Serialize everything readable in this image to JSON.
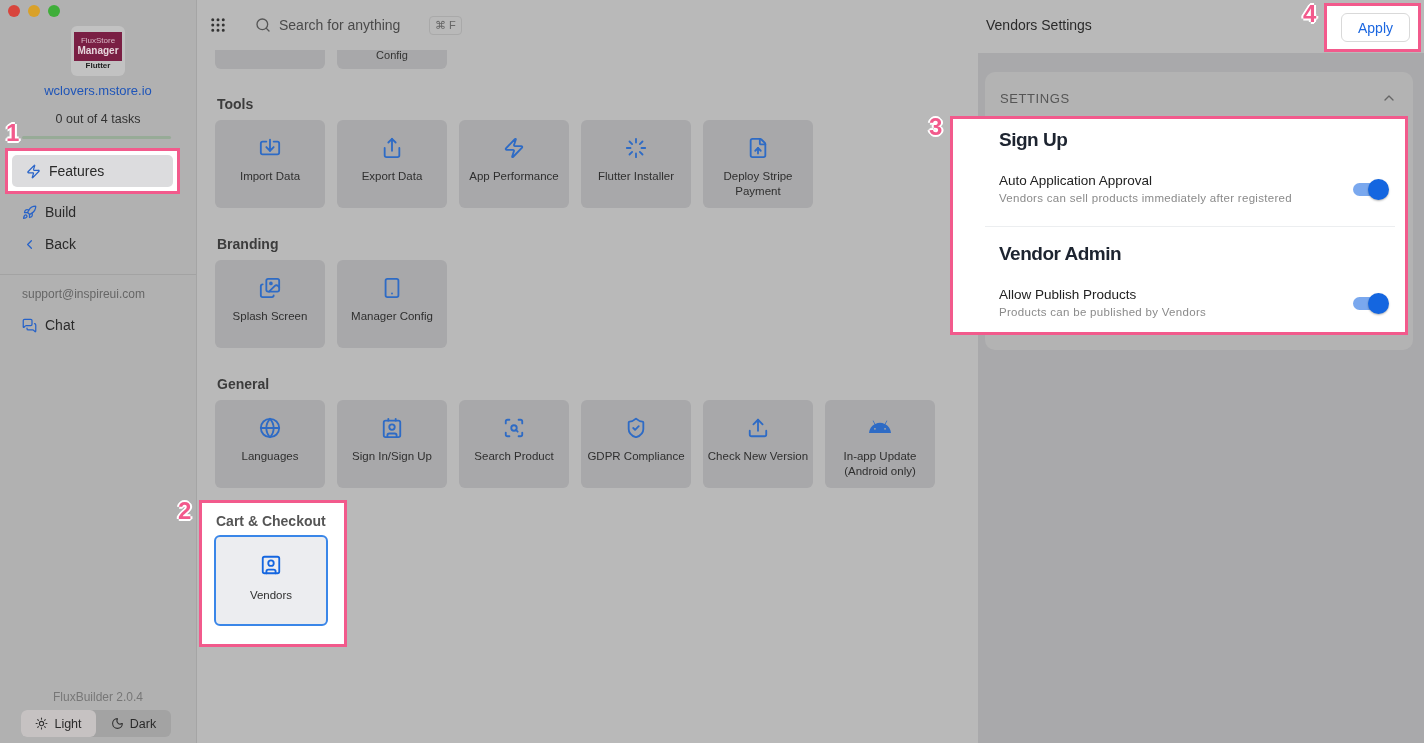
{
  "sidebar": {
    "logo": [
      "FluxStore",
      "Manager",
      "Flutter"
    ],
    "site": "wclovers.mstore.io",
    "tasks": "0 out of 4 tasks",
    "progress": {
      "level": 0
    },
    "nav": [
      {
        "label": "Features",
        "selected": true,
        "callout": "1"
      },
      {
        "label": "Build",
        "selected": false
      },
      {
        "label": "Back",
        "selected": false
      }
    ],
    "support": "support@inspireui.com",
    "chat": "Chat",
    "version": "FluxBuilder 2.0.4",
    "theme": [
      {
        "label": "Light",
        "selected": true
      },
      {
        "label": "Dark",
        "selected": false
      }
    ]
  },
  "topbar": {
    "search": {
      "placeholder": "Search for anything",
      "shortcut": "⌘ F"
    }
  },
  "partial_row": [
    {
      "kind": "blank"
    },
    {
      "kind": "text",
      "label": "Config"
    }
  ],
  "sections": [
    {
      "title": "Tools",
      "tiles": [
        {
          "label": "Import Data",
          "selected": false
        },
        {
          "label": "Export Data",
          "selected": false
        },
        {
          "label": "App Performance",
          "selected": false
        },
        {
          "label": "Flutter Installer",
          "selected": false
        },
        {
          "label": "Deploy Stripe Payment",
          "selected": false
        }
      ]
    },
    {
      "title": "Branding",
      "tiles": [
        {
          "label": "Splash Screen",
          "selected": false
        },
        {
          "label": "Manager Config",
          "selected": false
        }
      ]
    },
    {
      "title": "General",
      "tiles": [
        {
          "label": "Languages",
          "selected": false
        },
        {
          "label": "Sign In/Sign Up",
          "selected": false
        },
        {
          "label": "Search Product",
          "selected": false
        },
        {
          "label": "GDPR Compliance",
          "selected": false
        },
        {
          "label": "Check New Version",
          "selected": false
        },
        {
          "label": "In-app Update (Android only)",
          "selected": false
        }
      ]
    },
    {
      "title": "Cart & Checkout",
      "callout": "2",
      "tiles": [
        {
          "label": "Vendors",
          "selected": true
        }
      ]
    }
  ],
  "settings_panel": {
    "title": "Vendors Settings",
    "apply": {
      "label": "Apply",
      "callout": "4"
    },
    "section": {
      "title": "SETTINGS",
      "expanded": true,
      "callout": "3",
      "groups": [
        {
          "title": "Sign Up",
          "rows": [
            {
              "label": "Auto Application Approval",
              "description": "Vendors can sell products immediately after registered",
              "on": true
            }
          ]
        },
        {
          "title": "Vendor Admin",
          "rows": [
            {
              "label": "Allow Publish Products",
              "description": "Products can be published by Vendors",
              "on": true
            }
          ]
        }
      ]
    }
  }
}
